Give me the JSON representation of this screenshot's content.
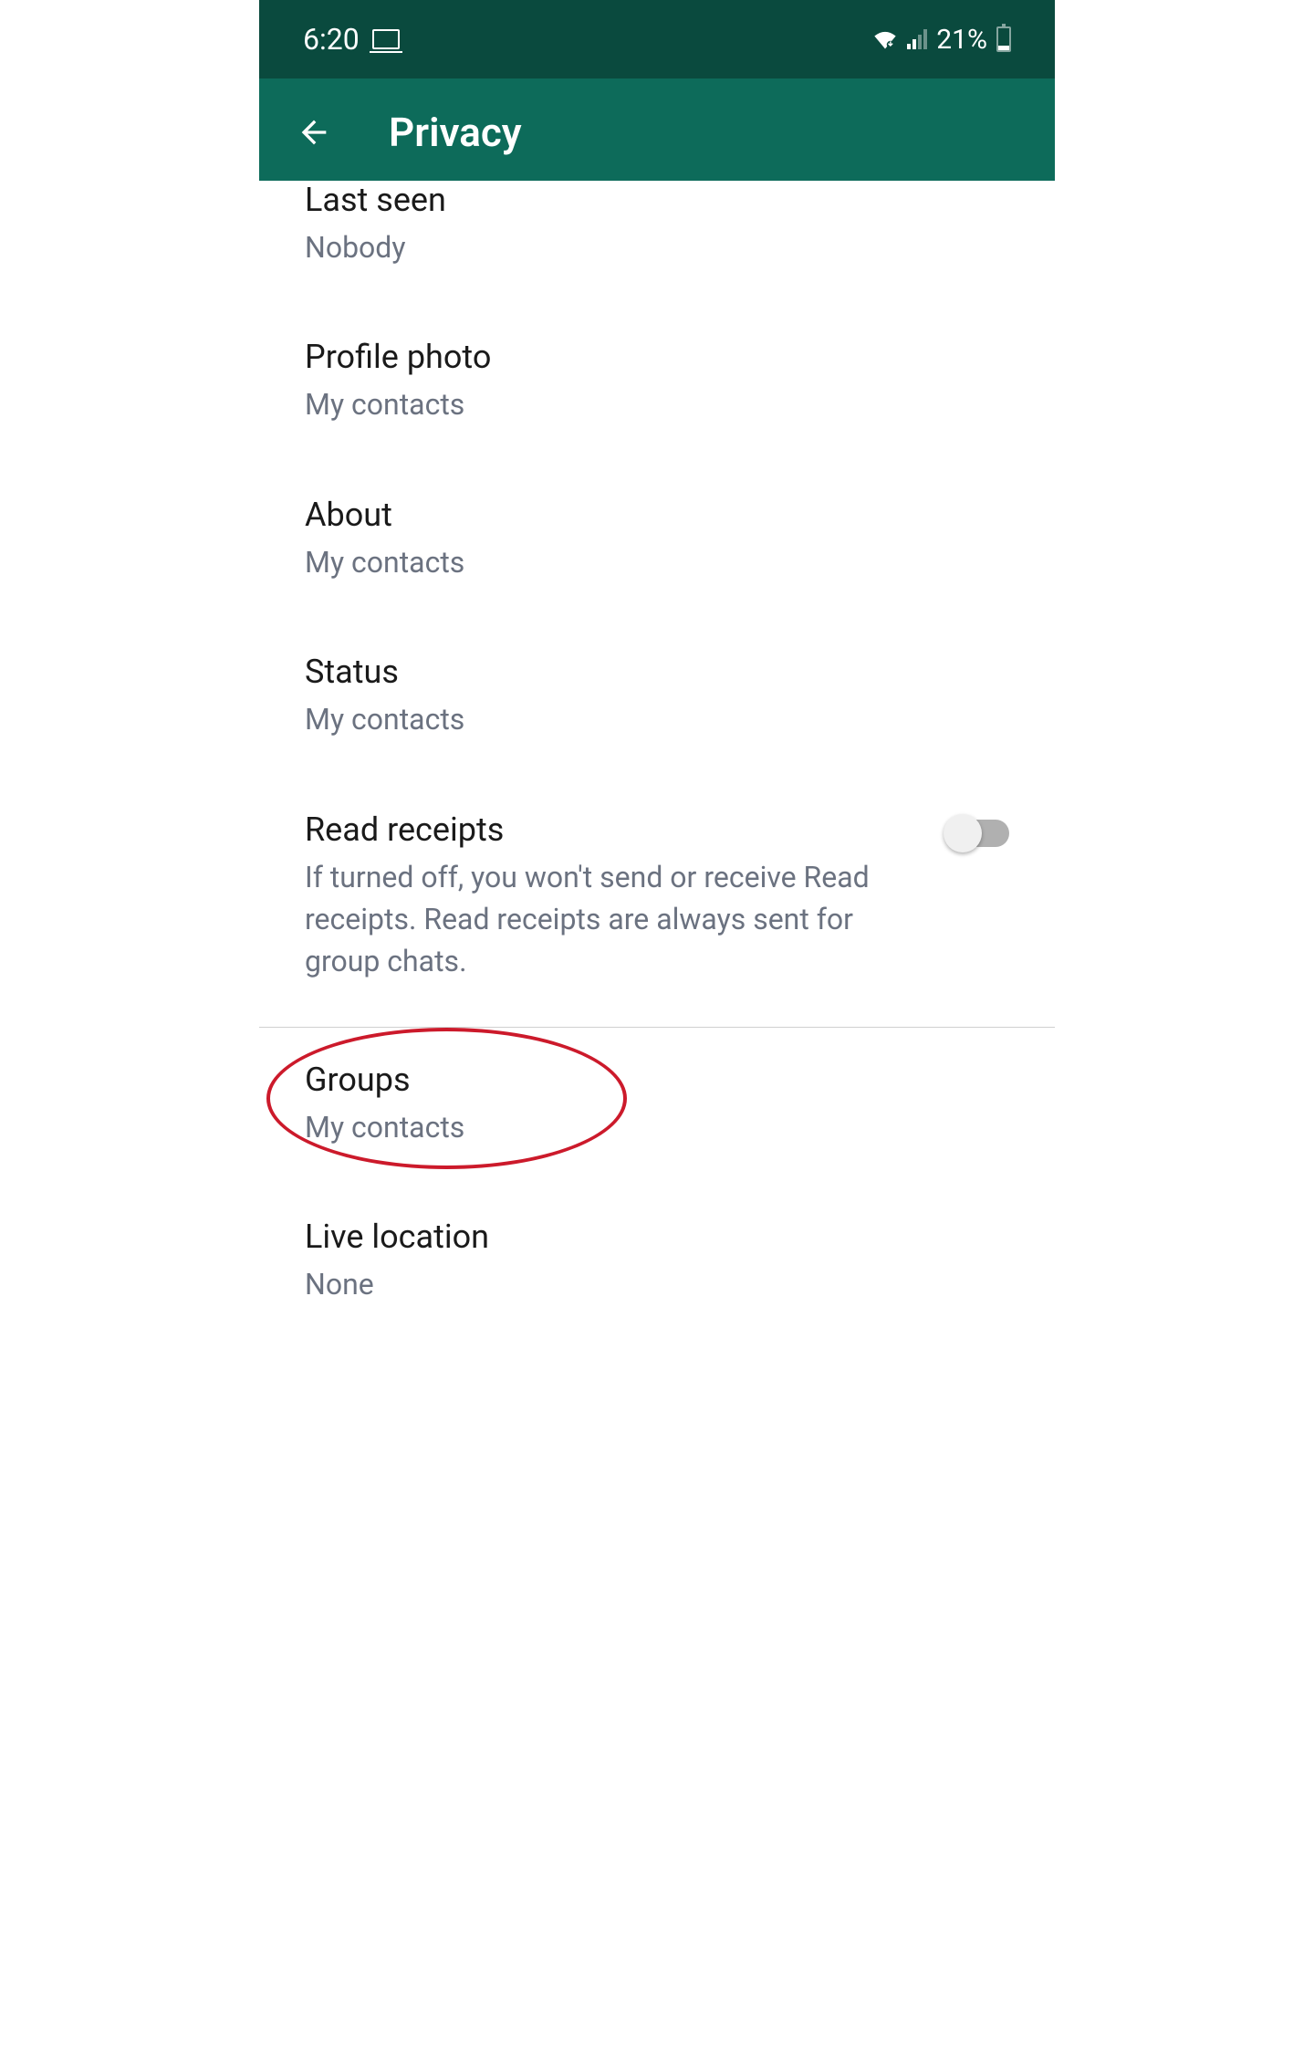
{
  "status_bar": {
    "time": "6:20",
    "battery_percent": "21%"
  },
  "header": {
    "title": "Privacy"
  },
  "settings": {
    "last_seen": {
      "title": "Last seen",
      "value": "Nobody"
    },
    "profile_photo": {
      "title": "Profile photo",
      "value": "My contacts"
    },
    "about": {
      "title": "About",
      "value": "My contacts"
    },
    "status": {
      "title": "Status",
      "value": "My contacts"
    },
    "read_receipts": {
      "title": "Read receipts",
      "description": "If turned off, you won't send or receive Read receipts. Read receipts are always sent for group chats."
    },
    "groups": {
      "title": "Groups",
      "value": "My contacts"
    },
    "live_location": {
      "title": "Live location",
      "value": "None"
    }
  }
}
